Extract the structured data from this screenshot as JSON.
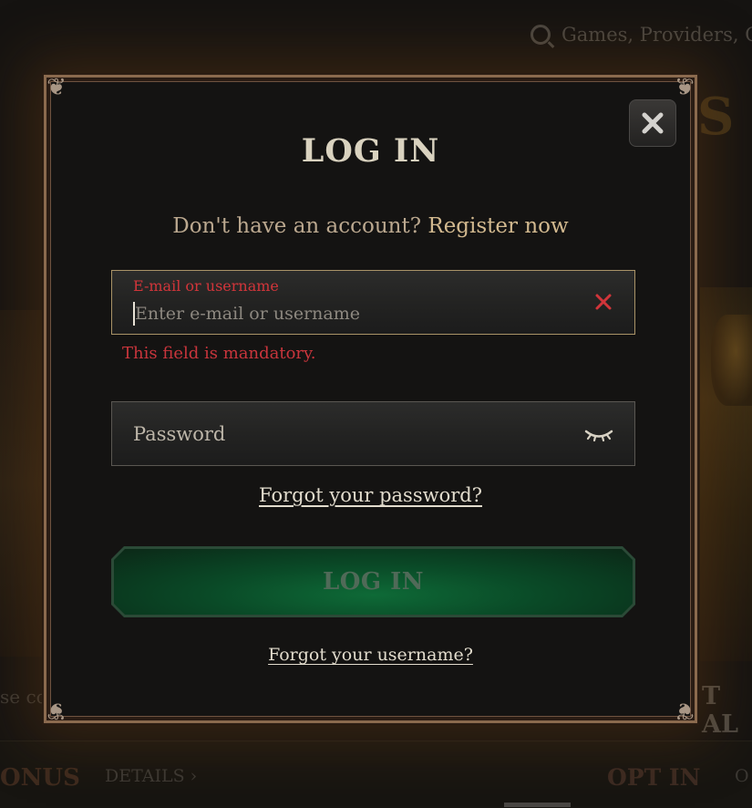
{
  "background": {
    "search_placeholder": "Games, Providers, G",
    "partial_s": "S",
    "partial_left_text": "se co",
    "partial_right_text": "T AL",
    "partial_bonus": "ONUS",
    "details_label": "DETAILS ›",
    "opt_in_label": "OPT IN",
    "partial_o": "O"
  },
  "modal": {
    "title": "LOG IN",
    "subtitle_prefix": "Don't have an account?",
    "register_link": "Register now",
    "username_field": {
      "label": "E-mail or username",
      "placeholder": "Enter e-mail or username",
      "value": "",
      "error": "This field is mandatory."
    },
    "password_field": {
      "placeholder": "Password",
      "value": ""
    },
    "forgot_password_link": "Forgot your password?",
    "login_button_label": "LOG IN",
    "forgot_username_link": "Forgot your username?"
  },
  "icons": {
    "close": "close-icon",
    "clear": "clear-x-icon",
    "password_toggle": "eye-closed-icon",
    "search": "search-icon"
  },
  "colors": {
    "error": "#d1353a",
    "accent_gold": "#d2b98f",
    "login_green": "#0e6a37",
    "frame": "#8b6a4e"
  }
}
